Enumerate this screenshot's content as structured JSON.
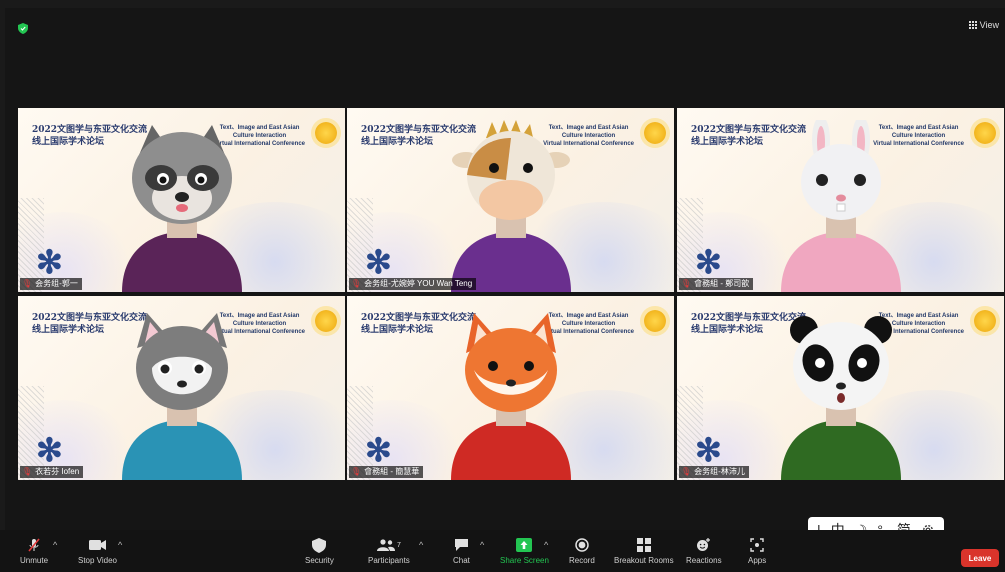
{
  "header": {
    "view_label": "View"
  },
  "tiles": [
    {
      "cn_title": "2022文图学与东亚文化交流\n线上国际学术论坛",
      "en_title": "Text、Image and East Asian\nCulture Interaction\nVirtual International Conference",
      "name": "会务组-郭一",
      "animal": "raccoon",
      "shirt": "#5a2458"
    },
    {
      "cn_title": "2022文图学与东亚文化交流\n线上国际学术论坛",
      "en_title": "Text、Image and East Asian\nCulture Interaction\nVirtual International Conference",
      "name": "会务组-尤婉婷 YOU Wan Teng",
      "animal": "cow",
      "shirt": "#6a2f8e"
    },
    {
      "cn_title": "2022文图学与东亚文化交流\n线上国际学术论坛",
      "en_title": "Text、Image and East Asian\nCulture Interaction\nVirtual International Conference",
      "name": "會務組 - 鄭司歆",
      "animal": "rabbit",
      "shirt": "#f0a7c0"
    },
    {
      "cn_title": "2022文图学与东亚文化交流\n线上国际学术论坛",
      "en_title": "Text、Image and East Asian\nCulture Interaction\nVirtual International Conference",
      "name": "衣若芬 Iofen",
      "animal": "husky",
      "shirt": "#2a93b5"
    },
    {
      "cn_title": "2022文图学与东亚文化交流\n线上国际学术论坛",
      "en_title": "Text、Image and East Asian\nCulture Interaction\nVirtual International Conference",
      "name": "會務組 - 簡慧華",
      "animal": "fox",
      "shirt": "#cf2a24"
    },
    {
      "cn_title": "2022文图学与东亚文化交流\n线上国际学术论坛",
      "en_title": "Text、Image and East Asian\nCulture Interaction\nVirtual International Conference",
      "name": "会务组-林沛儿",
      "animal": "panda",
      "shirt": "#2f6a22"
    }
  ],
  "ime_bar": {
    "cursor": "|",
    "mode": "中",
    "moon": "☽",
    "punct": "°,",
    "script": "简",
    "settings_icon": "gear-icon"
  },
  "toolbar": {
    "unmute": "Unmute",
    "stop_video": "Stop Video",
    "security": "Security",
    "participants": "Participants",
    "participants_count": "7",
    "chat": "Chat",
    "share_screen": "Share Screen",
    "record": "Record",
    "breakout_rooms": "Breakout Rooms",
    "reactions": "Reactions",
    "apps": "Apps",
    "leave": "Leave"
  },
  "colors": {
    "share_green": "#23c552",
    "leave_red": "#d9342b",
    "muted_red": "#e23b3b"
  }
}
